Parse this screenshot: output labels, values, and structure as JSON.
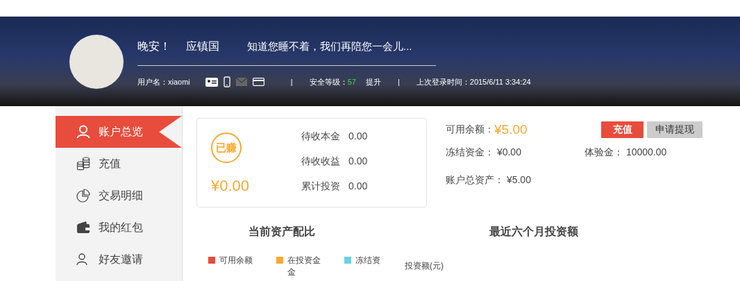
{
  "banner": {
    "greeting": "晚安！",
    "name": "应镇国",
    "slogan": "知道您睡不着，我们再陪您一会儿...",
    "username_label": "用户名：",
    "username": "xiaomi",
    "verifications": [
      {
        "kind": "id",
        "on": true
      },
      {
        "kind": "phone",
        "on": true
      },
      {
        "kind": "email",
        "on": false
      },
      {
        "kind": "bankcard",
        "on": true
      }
    ],
    "separator": "|",
    "security_label": "安全等级：",
    "security_level": "57",
    "upgrade_link": "提升",
    "separator_2": "|",
    "last_login": "上次登录时间：2015/6/11 3:34:24"
  },
  "sidebar": {
    "items": [
      {
        "label": "账户总览",
        "kind": "user",
        "selected": true
      },
      {
        "label": "充值",
        "kind": "coins",
        "selected": false
      },
      {
        "label": "交易明细",
        "kind": "pie",
        "selected": false
      },
      {
        "label": "我的红包",
        "kind": "wallet",
        "selected": false
      },
      {
        "label": "好友邀请",
        "kind": "friends",
        "selected": false
      }
    ]
  },
  "earned_card": {
    "badge": "已赚",
    "amount": "¥0.00",
    "rows": [
      {
        "label": "待收本金",
        "value": "0.00"
      },
      {
        "label": "待收收益",
        "value": "0.00"
      },
      {
        "label": "累计投资",
        "value": "0.00"
      }
    ]
  },
  "balance": {
    "available_label": "可用余额：",
    "available": "¥5.00",
    "recharge_button": "充值",
    "withdraw_button": "申请提现",
    "frozen_label": "冻结资金：",
    "frozen": "¥0.00",
    "trial_label": "体验金：",
    "trial": "10000.00",
    "total_label": "账户总资产：",
    "total": "¥5.00"
  },
  "asset_chart": {
    "title": "当前资产配比",
    "legend": [
      {
        "label": "可用余额",
        "color": "#e84c3d"
      },
      {
        "label": "在投资金金",
        "color": "#f9a92f"
      },
      {
        "label": "冻结资",
        "color": "#6acfe8"
      }
    ]
  },
  "invest_chart": {
    "title": "最近六个月投资额",
    "ylabel": "投资额(元)"
  }
}
